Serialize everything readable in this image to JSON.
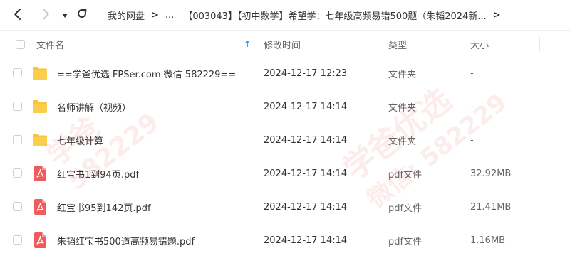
{
  "toolbar": {
    "back_icon": "chevron-left-icon",
    "forward_icon": "chevron-right-icon",
    "dropdown_icon": "caret-down-icon",
    "refresh_icon": "refresh-icon"
  },
  "breadcrumb": {
    "root": "我的网盘",
    "ellipsis": "...",
    "current": "【003043】【初中数学】希望学：七年级高频易错500题（朱韬2024新...",
    "separator": ">"
  },
  "columns": {
    "name": "文件名",
    "sort_indicator": "↑",
    "modified": "修改时间",
    "type": "类型",
    "size": "大小"
  },
  "rows": [
    {
      "name": "==学爸优选 FPSer.com 微信 582229==",
      "modified": "2024-12-17 12:23",
      "type": "文件夹",
      "size": "-",
      "icon": "folder-icon"
    },
    {
      "name": "名师讲解（视频）",
      "modified": "2024-12-17 14:14",
      "type": "文件夹",
      "size": "-",
      "icon": "folder-icon"
    },
    {
      "name": "七年级计算",
      "modified": "2024-12-17 14:14",
      "type": "文件夹",
      "size": "-",
      "icon": "folder-icon"
    },
    {
      "name": "红宝书1到94页.pdf",
      "modified": "2024-12-17 14:14",
      "type": "pdf文件",
      "size": "32.92MB",
      "icon": "pdf-icon"
    },
    {
      "name": "红宝书95到142页.pdf",
      "modified": "2024-12-17 14:14",
      "type": "pdf文件",
      "size": "21.41MB",
      "icon": "pdf-icon"
    },
    {
      "name": "朱韬红宝书500道高频易错题.pdf",
      "modified": "2024-12-17 14:14",
      "type": "pdf文件",
      "size": "1.16MB",
      "icon": "pdf-icon"
    }
  ],
  "watermark": {
    "line1": "学爸优选",
    "line2": "微信: 582229",
    "line3": "学爸",
    "line4": "582229"
  },
  "colors": {
    "folder": "#f8c53a",
    "pdf": "#ef5b5b",
    "sort_arrow": "#2b8cf0",
    "border": "#eeeeee"
  }
}
